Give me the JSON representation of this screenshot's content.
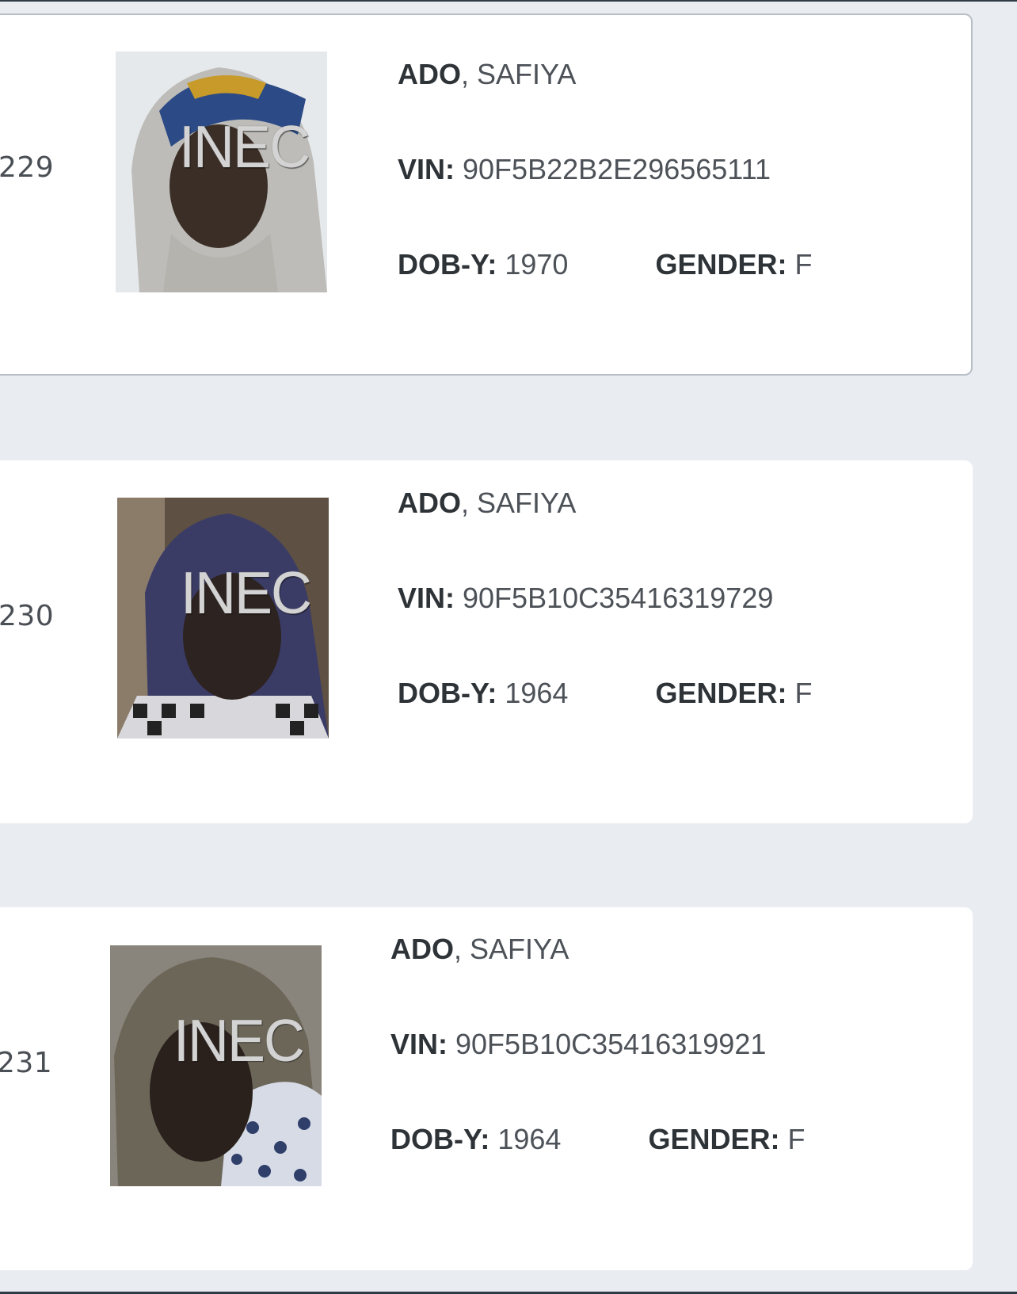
{
  "voters": [
    {
      "serial": "229",
      "surname": "ADO",
      "separator": ", ",
      "given_name": "SAFIYA",
      "vin_label": "VIN:",
      "vin": "90F5B22B2E296565111",
      "dob_label": "DOB-Y:",
      "dob_year": "1970",
      "gender_label": "GENDER:",
      "gender": "F",
      "photo_watermark": "INEC"
    },
    {
      "serial": "230",
      "surname": "ADO",
      "separator": ", ",
      "given_name": "SAFIYA",
      "vin_label": "VIN:",
      "vin": "90F5B10C35416319729",
      "dob_label": "DOB-Y:",
      "dob_year": "1964",
      "gender_label": "GENDER:",
      "gender": "F",
      "photo_watermark": "INEC"
    },
    {
      "serial": "231",
      "surname": "ADO",
      "separator": ", ",
      "given_name": "SAFIYA",
      "vin_label": "VIN:",
      "vin": "90F5B10C35416319921",
      "dob_label": "DOB-Y:",
      "dob_year": "1964",
      "gender_label": "GENDER:",
      "gender": "F",
      "photo_watermark": "INEC"
    }
  ],
  "colors": {
    "page_background": "#e9edf1",
    "card_background": "#ffffff",
    "selected_border": "#b9bfc6",
    "label_text": "#2e3338",
    "value_text": "#4d5258"
  }
}
